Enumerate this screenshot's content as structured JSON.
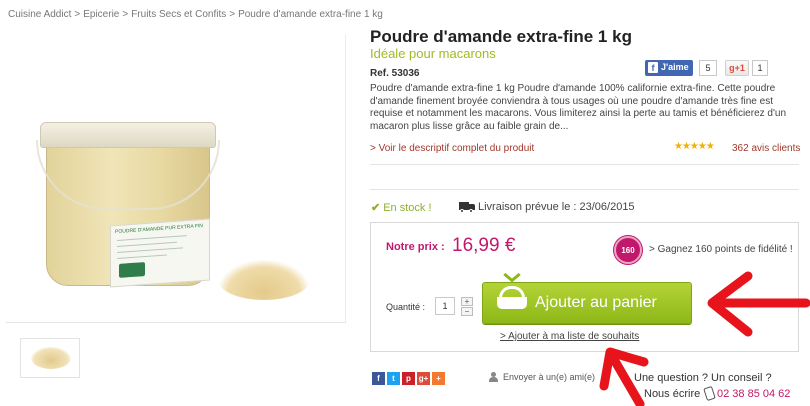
{
  "breadcrumb": [
    "Cuisine Addict",
    "Epicerie",
    "Fruits Secs et Confits",
    "Poudre d'amande extra-fine 1 kg"
  ],
  "breadcrumb_separator": ">",
  "product": {
    "title": "Poudre d'amande extra-fine 1 kg",
    "subtitle": "Idéale pour macarons",
    "ref": "Ref. 53036",
    "description": "Poudre d'amande extra-fine 1 kg Poudre d'amande 100% californie extra-fine. Cette poudre d'amande finement broyée conviendra à tous usages où une poudre d'amande très fine est requise et notamment les macarons. Vous limiterez ainsi la perte au tamis et bénéficierez d'un macaron plus lisse grâce au faible grain de...",
    "full_description_link": "> Voir le descriptif complet du produit",
    "stars": "★★★★★",
    "rating": 5,
    "reviews": "362 avis clients",
    "image_label": "POUDRE D'AMANDE PUR EXTRA FIN"
  },
  "social_top": {
    "facebook_label": "J'aime",
    "facebook_count": "5",
    "gplus_label": "+1",
    "gplus_count": "1"
  },
  "availability": {
    "stock_check": "✔",
    "stock": "En stock !",
    "delivery": "Livraison prévue le : 23/06/2015"
  },
  "buy": {
    "price_label": "Notre prix :",
    "price": "16,99 €",
    "points_badge": "160",
    "points_text": "> Gagnez 160 points de fidélité !",
    "quantity_label": "Quantité :",
    "quantity_value": "1",
    "plus": "+",
    "minus": "−",
    "add_to_cart": "Ajouter au panier",
    "wishlist": "> Ajouter à ma liste de souhaits"
  },
  "share": {
    "icons": [
      {
        "name": "facebook-share-icon",
        "glyph": "f",
        "color": "#3b5998"
      },
      {
        "name": "twitter-share-icon",
        "glyph": "t",
        "color": "#1da1f2"
      },
      {
        "name": "pinterest-share-icon",
        "glyph": "p",
        "color": "#cb2027"
      },
      {
        "name": "googleplus-share-icon",
        "glyph": "g+",
        "color": "#dd4b39"
      },
      {
        "name": "more-share-icon",
        "glyph": "+",
        "color": "#f4792f"
      }
    ],
    "send_friend": "Envoyer à un(e) ami(e)"
  },
  "contact": {
    "question": "Une question ? Un conseil ?",
    "write_us": "Nous écrire",
    "phone": "02 38 85 04 62"
  },
  "colors": {
    "accent_green": "#8db817",
    "price_pink": "#c2186b",
    "annotation_red": "#e8141c"
  }
}
